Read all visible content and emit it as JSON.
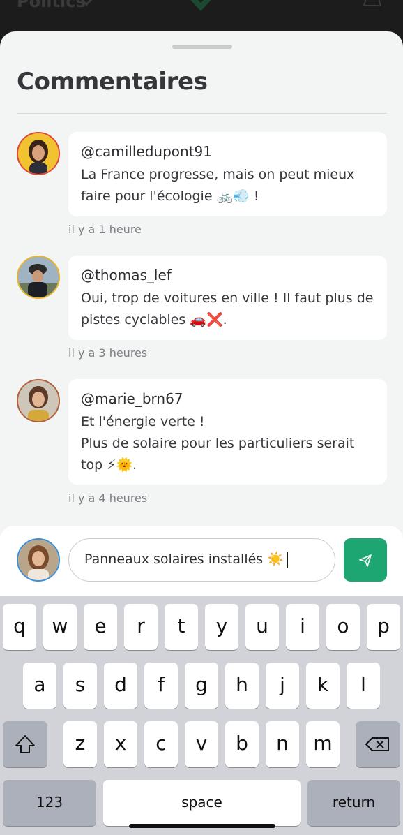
{
  "background": {
    "title": "Politics"
  },
  "sheet": {
    "title": "Commentaires"
  },
  "comments": [
    {
      "handle": "@camilledupont91",
      "text": "La France progresse, mais on peut mieux faire pour l'écologie 🚲💨 !",
      "time": "il y a 1 heure"
    },
    {
      "handle": "@thomas_lef",
      "text": "Oui, trop de voitures en ville ! Il faut plus de pistes cyclables 🚗❌.",
      "time": "il y a 3 heures"
    },
    {
      "handle": "@marie_brn67",
      "text_line1": "Et l'énergie verte !",
      "text_line2": "Plus de solaire pour les particuliers serait top ⚡🌞.",
      "time": "il y a 4 heures"
    }
  ],
  "compose": {
    "value": "Panneaux solaires installés ☀️",
    "send_icon": "send-icon"
  },
  "keyboard": {
    "row1": [
      "q",
      "w",
      "e",
      "r",
      "t",
      "y",
      "u",
      "i",
      "o",
      "p"
    ],
    "row2": [
      "a",
      "s",
      "d",
      "f",
      "g",
      "h",
      "j",
      "k",
      "l"
    ],
    "row3": [
      "z",
      "x",
      "c",
      "v",
      "b",
      "n",
      "m"
    ],
    "numbers_label": "123",
    "space_label": "space",
    "return_label": "return"
  }
}
